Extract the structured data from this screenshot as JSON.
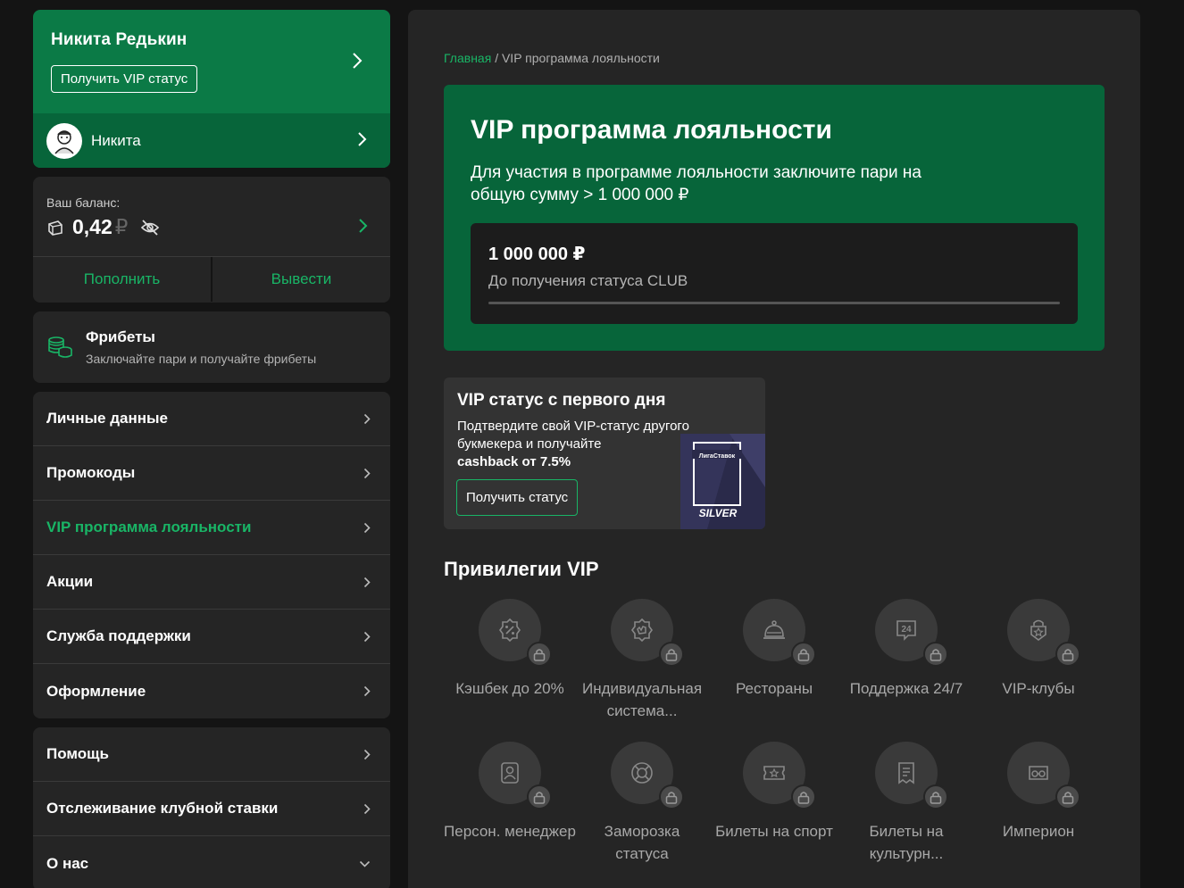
{
  "profile": {
    "name": "Никита Редькин",
    "vip_button": "Получить VIP статус",
    "username": "Никита"
  },
  "balance": {
    "label": "Ваш баланс:",
    "amount": "0,42",
    "currency": "₽",
    "deposit": "Пополнить",
    "withdraw": "Вывести"
  },
  "freebets": {
    "title": "Фрибеты",
    "subtitle": "Заключайте пари и получайте фрибеты"
  },
  "menu_main": [
    {
      "label": "Личные данные",
      "active": false
    },
    {
      "label": "Промокоды",
      "active": false
    },
    {
      "label": "VIP программа лояльности",
      "active": true
    },
    {
      "label": "Акции",
      "active": false
    },
    {
      "label": "Служба поддержки",
      "active": false
    },
    {
      "label": "Оформление",
      "active": false
    }
  ],
  "menu_secondary": [
    {
      "label": "Помощь",
      "icon": "chevron-right-icon"
    },
    {
      "label": "Отслеживание клубной ставки",
      "icon": "chevron-right-icon"
    },
    {
      "label": "О нас",
      "icon": "chevron-down-icon"
    }
  ],
  "breadcrumb": {
    "home": "Главная",
    "separator": "/",
    "current": "VIP программа лояльности"
  },
  "hero": {
    "title": "VIP программа лояльности",
    "description": "Для участия в программе лояльности заключите пари на общую сумму > 1 000 000 ₽",
    "progress_amount": "1 000 000 ₽",
    "progress_label": "До получения статуса CLUB",
    "progress_fraction": 0
  },
  "promo": {
    "title": "VIP статус с первого дня",
    "description": "Подтвердите свой VIP-статус другого букмекера и получайте",
    "highlight": "cashback от 7.5%",
    "button": "Получить статус",
    "card_brand": "ЛигаСтавок",
    "card_level": "SILVER"
  },
  "privileges": {
    "title": "Привилегии VIP",
    "items": [
      {
        "label": "Кэшбек до 20%",
        "icon": "cashback-icon"
      },
      {
        "label": "Индивидуальная система...",
        "icon": "gear-hand-icon"
      },
      {
        "label": "Рестораны",
        "icon": "cloche-icon"
      },
      {
        "label": "Поддержка 24/7",
        "icon": "support-24-icon"
      },
      {
        "label": "VIP-клубы",
        "icon": "club-icon"
      },
      {
        "label": "Персон. менеджер",
        "icon": "manager-icon"
      },
      {
        "label": "Заморозка статуса",
        "icon": "lifebuoy-icon"
      },
      {
        "label": "Билеты на спорт",
        "icon": "sport-ticket-icon"
      },
      {
        "label": "Билеты на культурн...",
        "icon": "culture-ticket-icon"
      },
      {
        "label": "Империон",
        "icon": "imperion-icon"
      }
    ]
  },
  "colors": {
    "accent": "#19b566",
    "profile_green": "#0b7a46",
    "hero_green": "#07653a",
    "panel": "#252525",
    "background": "#141414"
  }
}
